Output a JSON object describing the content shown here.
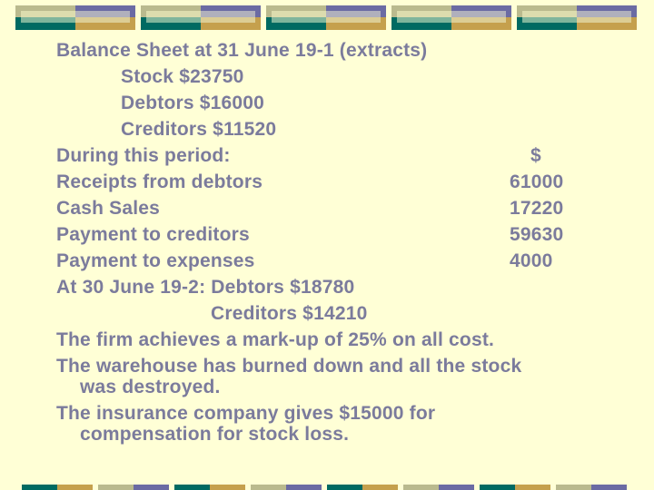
{
  "theme": {
    "background": "#FFFFD6",
    "text_color": "#7B7B9C",
    "accent_colors": {
      "olive": "#BABA8E",
      "teal": "#006A62",
      "purple": "#6B6BA3",
      "gold": "#C5A04D"
    }
  },
  "slide": {
    "balance_sheet": {
      "heading": "Balance Sheet at 31 June 19-1 (extracts)",
      "items": [
        {
          "label": "Stock $23750"
        },
        {
          "label": "Debtors $16000"
        },
        {
          "label": "Creditors $11520"
        }
      ]
    },
    "period": {
      "heading": "During this period:",
      "currency_header": "$",
      "rows": [
        {
          "label": "Receipts from debtors",
          "amount": "61000"
        },
        {
          "label": "Cash Sales",
          "amount": "17220"
        },
        {
          "label": "Payment to creditors",
          "amount": "59630"
        },
        {
          "label": "Payment to expenses",
          "amount": "4000"
        }
      ]
    },
    "closing": {
      "debtors_line": "At 30 June 19-2: Debtors $18780",
      "creditors_line": "Creditors $14210"
    },
    "notes": {
      "markup": "The firm achieves a mark-up of 25% on all cost.",
      "fire_line1": "The warehouse has burned down and all the stock",
      "fire_line2": "was destroyed.",
      "insurance_line1": "The insurance company gives $15000 for",
      "insurance_line2": "compensation for stock loss."
    }
  }
}
